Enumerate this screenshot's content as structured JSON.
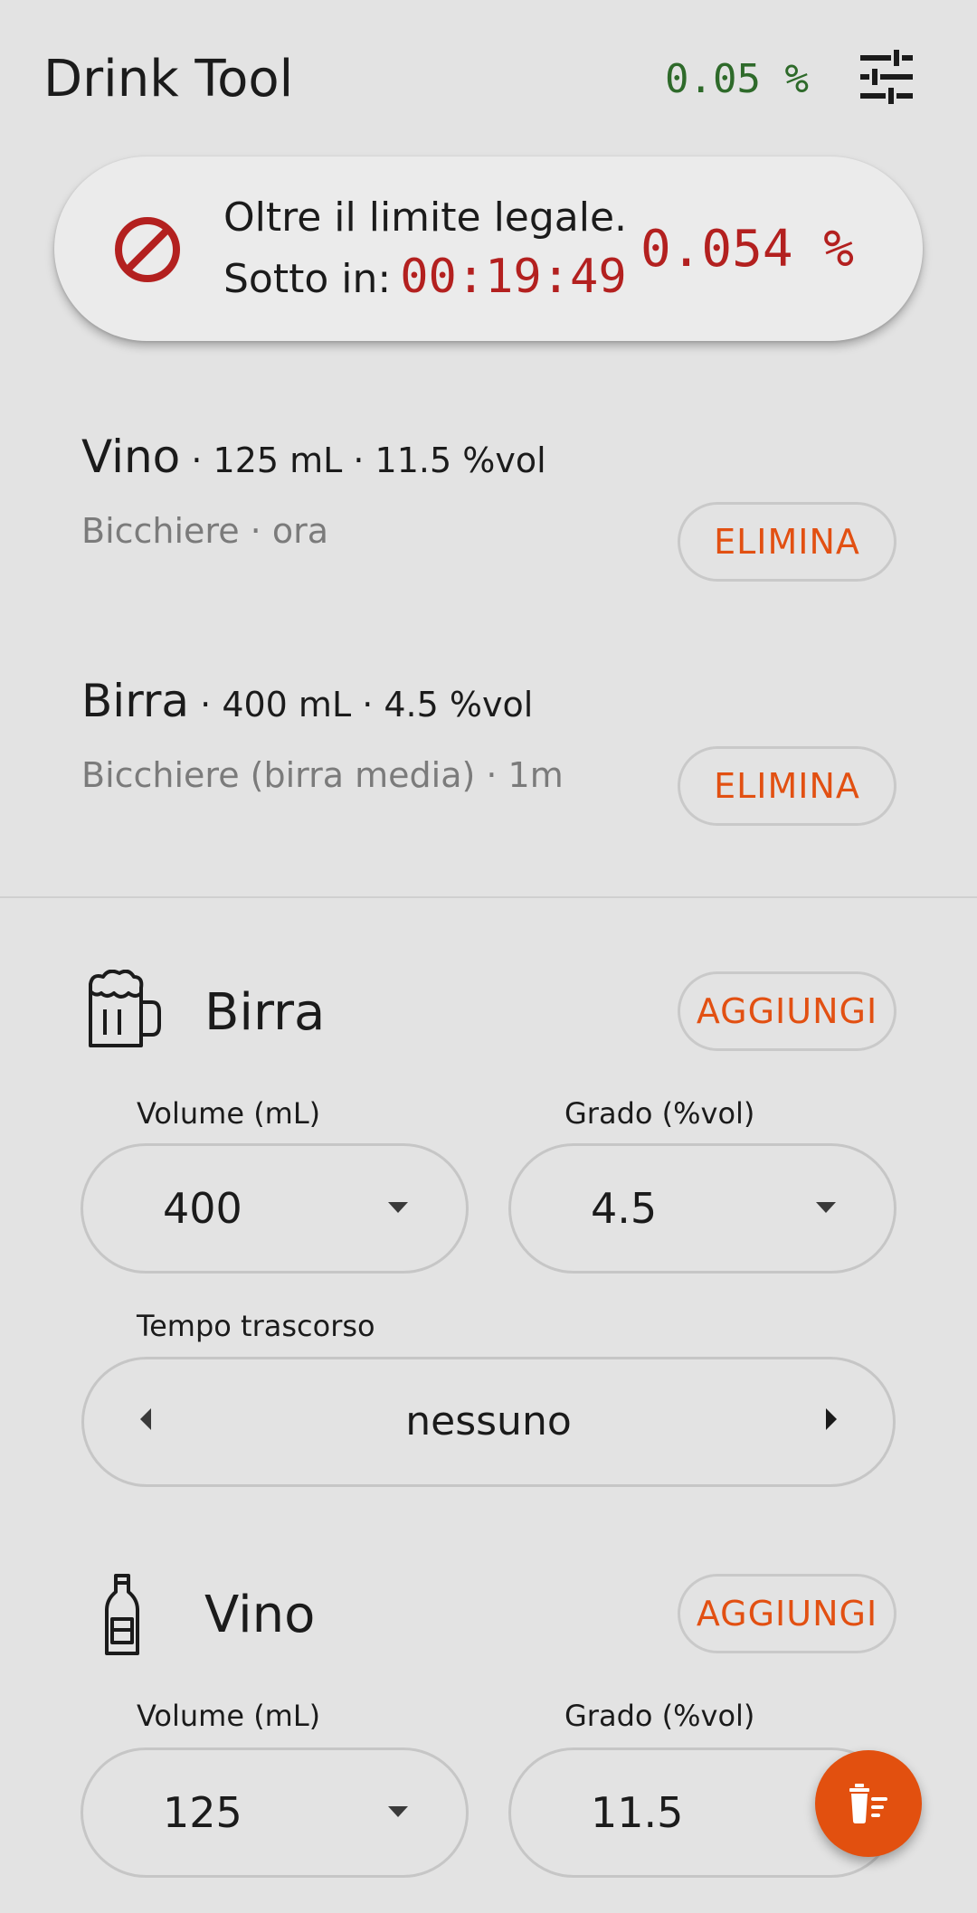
{
  "header": {
    "title": "Drink Tool",
    "legal_limit": "0.05 %",
    "settings_icon": "sliders-icon"
  },
  "status": {
    "icon": "prohibited-icon",
    "line1": "Oltre il limite legale.",
    "line2_prefix": "Sotto in:",
    "timer": "00:19:49",
    "bac": "0.054 %",
    "alert_color": "#b3201f"
  },
  "entries": [
    {
      "name": "Vino",
      "details": " · 125  mL · 11.5 %vol",
      "sub": "Bicchiere · ora",
      "delete_label": "ELIMINA"
    },
    {
      "name": "Birra",
      "details": " · 400  mL · 4.5 %vol",
      "sub": "Bicchiere (birra media) · 1m",
      "delete_label": "ELIMINA"
    }
  ],
  "sections": [
    {
      "icon": "beer-mug-icon",
      "name": "Birra",
      "add_label": "AGGIUNGI",
      "volume_label": "Volume (mL)",
      "volume_value": "400",
      "grade_label": "Grado (%vol)",
      "grade_value": "4.5",
      "time_label": "Tempo trascorso",
      "time_value": "nessuno"
    },
    {
      "icon": "wine-bottle-icon",
      "name": "Vino",
      "add_label": "AGGIUNGI",
      "volume_label": "Volume (mL)",
      "volume_value": "125",
      "grade_label": "Grado (%vol)",
      "grade_value": "11.5"
    }
  ],
  "fab": {
    "icon": "clear-list-icon"
  },
  "colors": {
    "accent": "#e2500f",
    "ok_green": "#2e6a2a",
    "alert_red": "#b3201f",
    "background": "#e3e3e3"
  }
}
